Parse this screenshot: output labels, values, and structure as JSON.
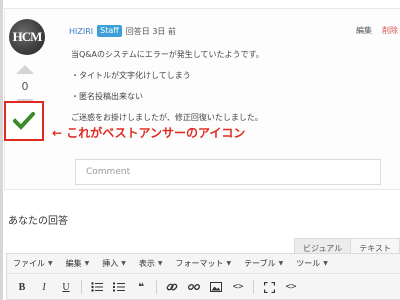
{
  "answer": {
    "avatar_text": "HCM",
    "author": "HIZIRI",
    "badge": "Staff",
    "answered": "回答日 3日 前",
    "edit": "編集",
    "delete": "削除",
    "vote_count": "0",
    "lines": [
      "当Q&Aのシステムにエラーが発生していたようです。",
      "・タイトルが文字化けしてしまう",
      "・匿名投稿出来ない",
      "ご迷惑をお掛けしましたが、修正回復いたしました。"
    ],
    "best_answer_icon": "checkmark-icon",
    "comment_placeholder": "Comment"
  },
  "annotation": {
    "text": "← これがベストアンサーのアイコン",
    "color": "#e02a1f"
  },
  "your_answer": {
    "title": "あなたの回答",
    "tabs": [
      "ビジュアル",
      "テキスト"
    ]
  },
  "editor": {
    "menu": [
      "ファイル",
      "編集",
      "挿入",
      "表示",
      "フォーマット",
      "テーブル",
      "ツール"
    ],
    "toolbar_icons": [
      "bold-icon",
      "italic-icon",
      "underline-icon",
      "bullet-list-icon",
      "numbered-list-icon",
      "blockquote-icon",
      "link-icon",
      "unlink-icon",
      "image-icon",
      "code-icon",
      "fullscreen-icon",
      "source-code-icon"
    ]
  },
  "colors": {
    "accent_red": "#e02a1f",
    "check_green": "#3c8b2a",
    "staff_badge": "#3ea0d8",
    "author_link": "#3a7bc8"
  }
}
